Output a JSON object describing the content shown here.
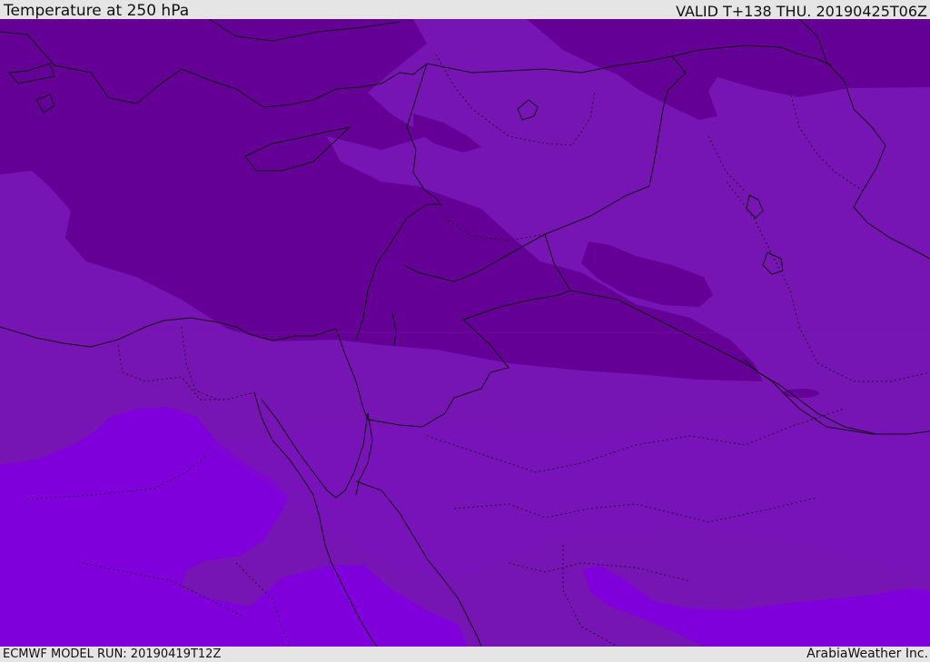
{
  "header": {
    "title": "Temperature at 250 hPa",
    "valid": "VALID T+138 THU. 20190425T06Z"
  },
  "footer": {
    "model_run": "ECMWF MODEL RUN: 20190419T12Z",
    "credit": "ArabiaWeather Inc."
  },
  "map": {
    "colors": {
      "coldest": "#650096",
      "cold": "#7614b4",
      "mid": "#7d10c4",
      "warm": "#8000db",
      "borders": "#111111"
    }
  }
}
